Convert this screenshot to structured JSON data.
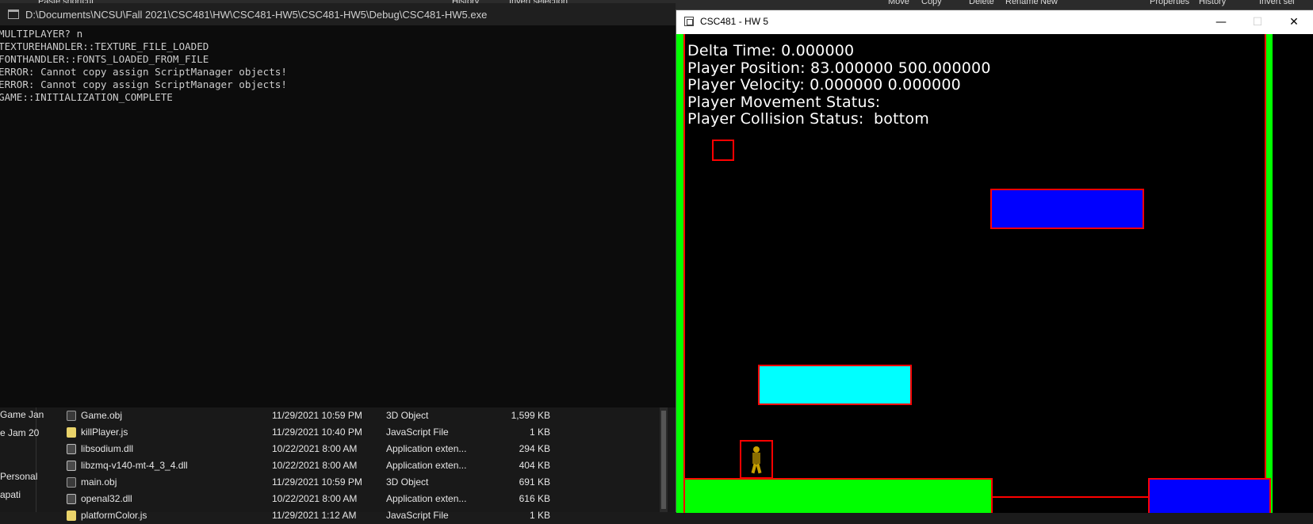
{
  "background_ribbon": {
    "items": [
      "Paste shortcut",
      "History",
      "Invert selection",
      "Move",
      "Copy",
      "Delete",
      "Rename",
      "New",
      "Properties",
      "History",
      "Invert sel"
    ]
  },
  "console": {
    "title": "D:\\Documents\\NCSU\\Fall 2021\\CSC481\\HW\\CSC481-HW5\\CSC481-HW5\\Debug\\CSC481-HW5.exe",
    "lines": [
      "MULTIPLAYER? n",
      "TEXTUREHANDLER::TEXTURE_FILE_LOADED",
      "FONTHANDLER::FONTS_LOADED_FROM_FILE",
      "ERROR: Cannot copy assign ScriptManager objects!",
      "ERROR: Cannot copy assign ScriptManager objects!",
      "GAME::INITIALIZATION_COMPLETE"
    ]
  },
  "explorer": {
    "nav_items": [
      "Game Jan",
      "e Jam 20",
      "Personal",
      "apati"
    ],
    "files": [
      {
        "name": "Game.obj",
        "date": "11/29/2021 10:59 PM",
        "type": "3D Object",
        "size": "1,599 KB",
        "icon": "obj-file-icon"
      },
      {
        "name": "killPlayer.js",
        "date": "11/29/2021 10:40 PM",
        "type": "JavaScript File",
        "size": "1 KB",
        "icon": "js-file-icon"
      },
      {
        "name": "libsodium.dll",
        "date": "10/22/2021 8:00 AM",
        "type": "Application exten...",
        "size": "294 KB",
        "icon": "dll-file-icon"
      },
      {
        "name": "libzmq-v140-mt-4_3_4.dll",
        "date": "10/22/2021 8:00 AM",
        "type": "Application exten...",
        "size": "404 KB",
        "icon": "dll-file-icon"
      },
      {
        "name": "main.obj",
        "date": "11/29/2021 10:59 PM",
        "type": "3D Object",
        "size": "691 KB",
        "icon": "obj-file-icon"
      },
      {
        "name": "openal32.dll",
        "date": "10/22/2021 8:00 AM",
        "type": "Application exten...",
        "size": "616 KB",
        "icon": "dll-file-icon"
      },
      {
        "name": "platformColor.js",
        "date": "11/29/2021 1:12 AM",
        "type": "JavaScript File",
        "size": "1 KB",
        "icon": "js-file-icon"
      }
    ]
  },
  "game": {
    "title": "CSC481 - HW 5",
    "hud": {
      "delta_time": "Delta Time: 0.000000",
      "position": "Player Position: 83.000000 500.000000",
      "velocity": "Player Velocity: 0.000000 0.000000",
      "movement": "Player Movement Status:",
      "collision": "Player Collision Status:  bottom"
    },
    "colors": {
      "wall": "#00ff00",
      "outline": "#ff0000",
      "blue_platform": "#0000ff",
      "cyan_platform": "#00ffff",
      "ground": "#00ff00"
    }
  }
}
